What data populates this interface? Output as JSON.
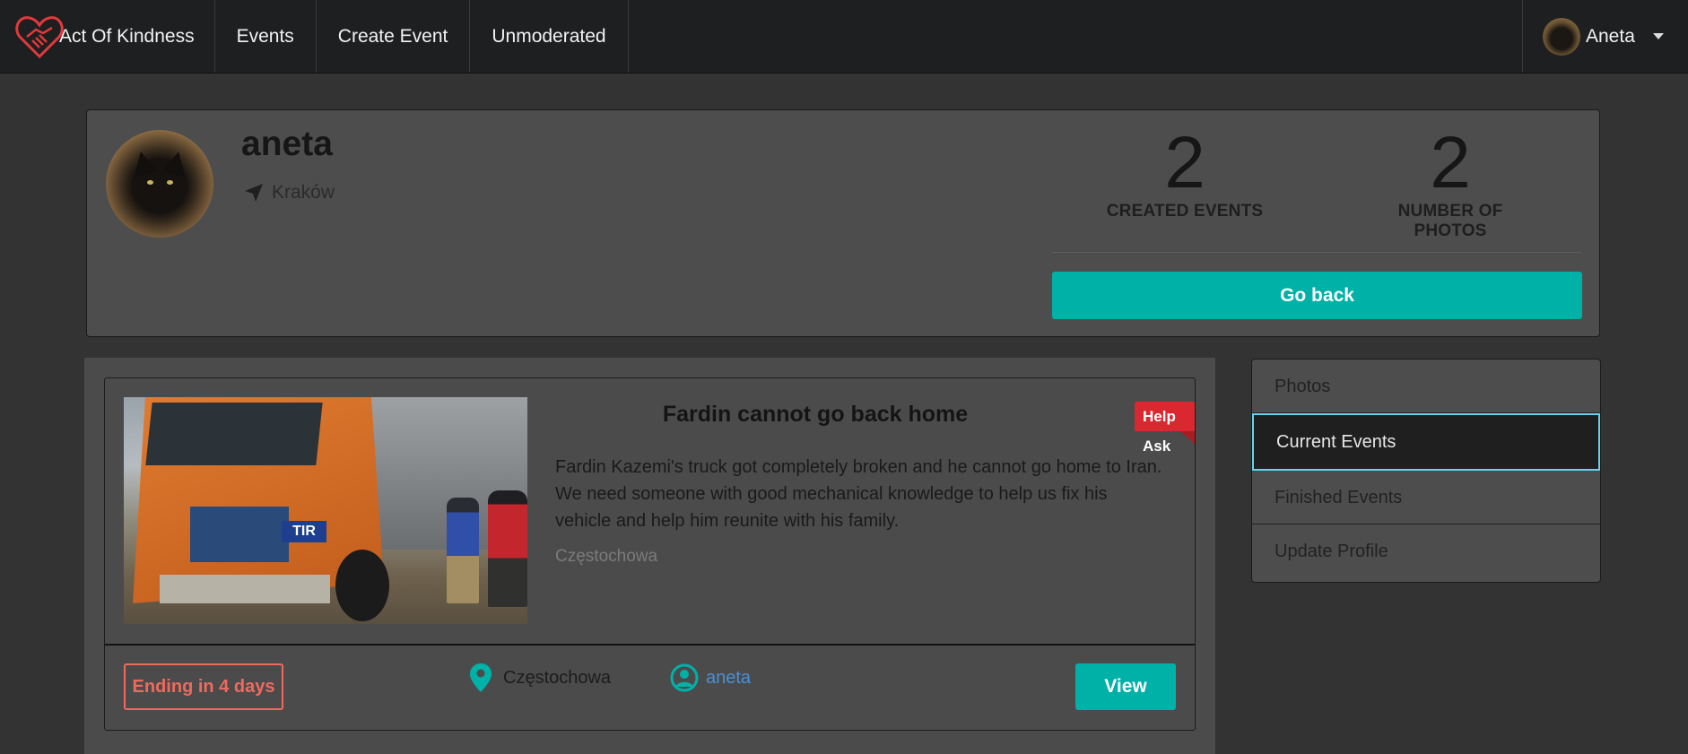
{
  "navbar": {
    "brand": "Act Of Kindness",
    "items": [
      {
        "label": "Events"
      },
      {
        "label": "Create Event"
      },
      {
        "label": "Unmoderated"
      }
    ],
    "user": {
      "name": "Aneta"
    }
  },
  "profile": {
    "name": "aneta",
    "location": "Kraków",
    "stats": [
      {
        "value": "2",
        "label": "CREATED EVENTS"
      },
      {
        "value": "2",
        "label": "NUMBER OF PHOTOS"
      }
    ],
    "go_back_label": "Go back"
  },
  "event": {
    "badge": "Help Ask",
    "title": "Fardin cannot go back home",
    "description": "Fardin Kazemi's truck got completely broken and he cannot go home to Iran. We need someone with good mechanical knowledge to help us fix his vehicle and help him reunite with his family.",
    "city": "Częstochowa",
    "photo_text": "TIR",
    "ending_label": "Ending in 4 days",
    "location": "Częstochowa",
    "author": "aneta",
    "view_label": "View"
  },
  "sidebar": {
    "items": [
      {
        "label": "Photos"
      },
      {
        "label": "Current Events"
      },
      {
        "label": "Finished Events"
      },
      {
        "label": "Update Profile"
      }
    ]
  },
  "colors": {
    "accent": "#00b1a8",
    "danger": "#d9282f",
    "ending": "#ef6a5e",
    "link": "#4a90d9",
    "active_border": "#66d2f0",
    "navbar_bg": "#1e1f20",
    "page_bg": "#333333"
  },
  "icons": {
    "brand": "heart-handshake-icon",
    "location_arrow": "location-arrow-icon",
    "map_pin": "map-pin-icon",
    "user": "user-circle-icon",
    "dropdown": "caret-down-icon"
  }
}
